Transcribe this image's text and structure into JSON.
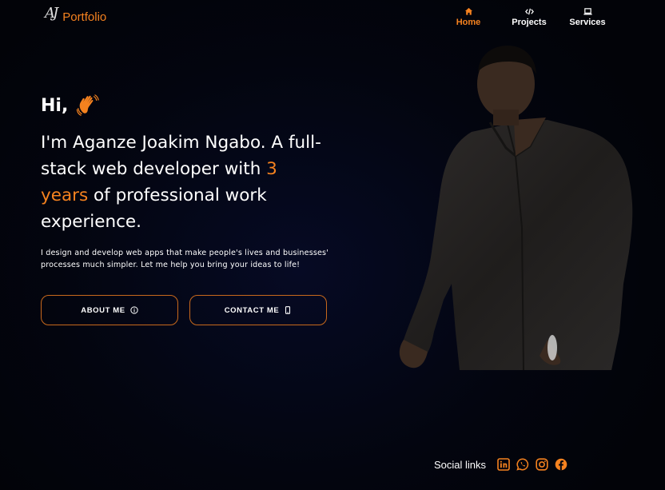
{
  "logo": {
    "mark": "AJ",
    "text": "Portfolio"
  },
  "nav": {
    "items": [
      {
        "label": "Home",
        "icon": "home-icon",
        "active": true
      },
      {
        "label": "Projects",
        "icon": "code-icon",
        "active": false
      },
      {
        "label": "Services",
        "icon": "laptop-icon",
        "active": false
      }
    ]
  },
  "hero": {
    "greeting": "Hi,",
    "headline_pre": "I'm Aganze Joakim Ngabo. A full-stack web developer with ",
    "headline_accent": "3 years",
    "headline_post": " of professional work experience.",
    "description": "I design and develop web apps that make people's lives and businesses' processes much simpler. Let me help you bring your ideas to life!"
  },
  "buttons": {
    "about_label": "ABOUT ME",
    "contact_label": "CONTACT ME"
  },
  "social": {
    "label": "Social links",
    "icons": [
      "linkedin-icon",
      "whatsapp-icon",
      "instagram-icon",
      "facebook-icon"
    ]
  },
  "colors": {
    "accent": "#f5821f",
    "background": "#03050f",
    "text": "#ffffff"
  }
}
